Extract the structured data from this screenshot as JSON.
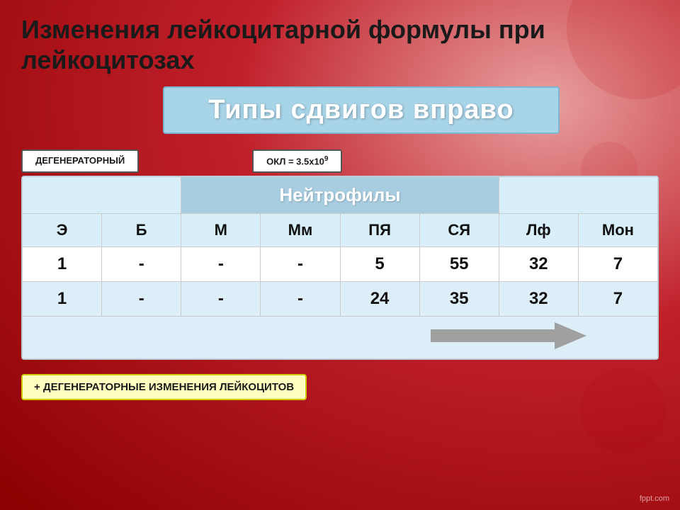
{
  "title": "Изменения лейкоцитарной формулы при лейкоцитозах",
  "subtitle": "Типы сдвигов вправо",
  "label_left": "ДЕГЕНЕРАТОРНЫЙ",
  "label_right": "ОКЛ = 3.5х10",
  "label_right_sup": "9",
  "neutrophils_header": "Нейтрофилы",
  "columns": [
    "Э",
    "Б",
    "М",
    "Мм",
    "ПЯ",
    "СЯ",
    "Лф",
    "Мон"
  ],
  "row1": [
    "1",
    "-",
    "-",
    "-",
    "5",
    "55",
    "32",
    "7"
  ],
  "row2": [
    "1",
    "-",
    "-",
    "-",
    "24",
    "35",
    "32",
    "7"
  ],
  "bottom_label": "+ ДЕГЕНЕРАТОРНЫЕ ИЗМЕНЕНИЯ ЛЕЙКОЦИТОВ",
  "watermark": "fppt.com",
  "row1_colors": [
    "normal",
    "normal",
    "normal",
    "normal",
    "blue",
    "blue",
    "normal",
    "normal"
  ],
  "row2_colors": [
    "normal",
    "normal",
    "normal",
    "normal",
    "orange",
    "orange",
    "normal",
    "normal"
  ]
}
